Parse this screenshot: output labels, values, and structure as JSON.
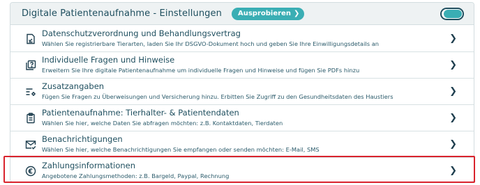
{
  "header": {
    "title": "Digitale Patientenaufnahme - Einstellungen",
    "try_button": "Ausprobieren",
    "try_button_chevron": "❯",
    "toggle_state": "on"
  },
  "rows": [
    {
      "icon": "document-sign-icon",
      "title": "Datenschutzverordnung und Behandlungsvertrag",
      "desc": "Wählen Sie registrierbare Tierarten, laden Sie Ihr DSGVO-Dokument hoch und geben Sie Ihre Einwilligungsdetails an"
    },
    {
      "icon": "question-copy-icon",
      "title": "Individuelle Fragen und Hinweise",
      "desc": "Erweitern Sie Ihre digitale Patientenaufnahme um individuelle Fragen und Hinweise und fügen Sie PDFs hinzu"
    },
    {
      "icon": "settings-list-icon",
      "title": "Zusatzangaben",
      "desc": "Fügen Sie Fragen zu Überweisungen und Versicherung hinzu. Erbitten Sie Zugriff zu den Gesundheitsdaten des Haustiers"
    },
    {
      "icon": "clipboard-icon",
      "title": "Patientenaufnahme: Tierhalter- & Patientendaten",
      "desc": "Wählen Sie hier, welche Daten Sie abfragen möchten: z.B. Kontaktdaten, Tierdaten"
    },
    {
      "icon": "mail-check-icon",
      "title": "Benachrichtigungen",
      "desc": "Wählen Sie hier, welche Benachrichtigungen Sie empfangen oder senden möchten: E-Mail, SMS"
    },
    {
      "icon": "euro-icon",
      "title": "Zahlungsinformationen",
      "desc": "Angebotene Zahlungsmethoden: z.B. Bargeld, Paypal, Rechnung"
    }
  ],
  "chevron": "❯",
  "colors": {
    "accent": "#3aaeb4",
    "text": "#1f4f5f",
    "header_bg": "#eef2f3",
    "highlight": "#d9232d"
  }
}
